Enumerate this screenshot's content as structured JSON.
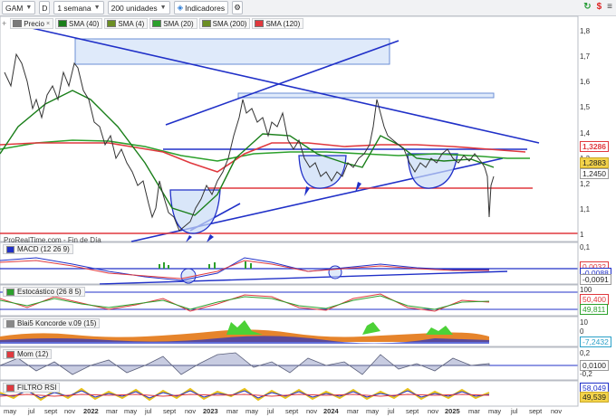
{
  "toolbar": {
    "symbol": "GAM",
    "mode": "D",
    "period": "1 semana",
    "units": "200 unidades",
    "indicators": "Indicadores"
  },
  "legend": [
    {
      "label": "Precio",
      "color": "#7a7a7a"
    },
    {
      "label": "SMA (40)",
      "color": "#1a7f1a"
    },
    {
      "label": "SMA (4)",
      "color": "#6b8e23"
    },
    {
      "label": "SMA (20)",
      "color": "#2ca02c"
    },
    {
      "label": "SMA (200)",
      "color": "#6b8e23"
    },
    {
      "label": "SMA (120)",
      "color": "#e0393e"
    }
  ],
  "price_axis": [
    "1,8",
    "1,7",
    "1,6",
    "1,5",
    "1,4",
    "1,3",
    "1,2",
    "1,1",
    "1"
  ],
  "price_tags": {
    "last": "1,3286",
    "current": "1,2883",
    "secondary": "1,2450"
  },
  "watermark": "ProRealTime.com - Fin de Día",
  "panels": {
    "macd": {
      "label": "MACD (12 26 9)",
      "axis": [
        "0,1"
      ],
      "tags": [
        "0,0032",
        "-0,0088",
        "-0,0091"
      ]
    },
    "stoch": {
      "label": "Estocástico (26 8 5)",
      "axis": [
        "100"
      ],
      "tags": [
        "50,400",
        "49,811"
      ]
    },
    "koncorde": {
      "label": "Blai5 Koncorde v.09 (15)",
      "axis": [
        "10",
        "0"
      ],
      "tags": [
        "-7,2432"
      ]
    },
    "mom": {
      "label": "Mom (12)",
      "axis": [
        "0,2",
        "-0,2"
      ],
      "tags": [
        "0,0100"
      ]
    },
    "rsi": {
      "label": "FILTRO RSI",
      "axis": [],
      "tags": [
        "58,049",
        "49,539"
      ]
    }
  },
  "xaxis": [
    "may",
    "jul",
    "sept",
    "nov",
    "2022",
    "mar",
    "may",
    "jul",
    "sept",
    "nov",
    "2023",
    "mar",
    "may",
    "jul",
    "sept",
    "nov",
    "2024",
    "mar",
    "may",
    "jul",
    "sept",
    "nov",
    "2025",
    "mar",
    "may",
    "jul",
    "sept",
    "nov"
  ]
}
